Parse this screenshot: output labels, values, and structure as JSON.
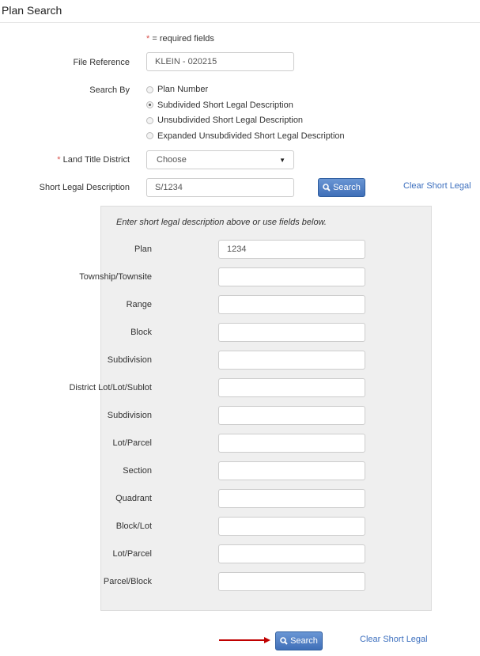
{
  "title": "Plan Search",
  "required_note": {
    "star": "*",
    "text": " = required fields"
  },
  "file_reference": {
    "label": "File Reference",
    "value": "KLEIN - 020215"
  },
  "search_by": {
    "label": "Search By",
    "options": [
      {
        "label": "Plan Number",
        "checked": false
      },
      {
        "label": "Subdivided Short Legal Description",
        "checked": true
      },
      {
        "label": "Unsubdivided Short Legal Description",
        "checked": false
      },
      {
        "label": "Expanded Unsubdivided Short Legal Description",
        "checked": false
      }
    ]
  },
  "land_title_district": {
    "star": "*",
    "label": " Land Title District",
    "value": "Choose"
  },
  "short_legal": {
    "label": "Short Legal Description",
    "value": "S/1234",
    "search_label": "Search",
    "clear_label": "Clear Short Legal"
  },
  "panel": {
    "instruction": "Enter short legal description above or use fields below.",
    "fields": [
      {
        "label": "Plan",
        "value": "1234"
      },
      {
        "label": "Township/Townsite",
        "value": ""
      },
      {
        "label": "Range",
        "value": ""
      },
      {
        "label": "Block",
        "value": ""
      },
      {
        "label": "Subdivision",
        "value": ""
      },
      {
        "label": "District Lot/Lot/Sublot",
        "value": ""
      },
      {
        "label": "Subdivision",
        "value": ""
      },
      {
        "label": "Lot/Parcel",
        "value": ""
      },
      {
        "label": "Section",
        "value": ""
      },
      {
        "label": "Quadrant",
        "value": ""
      },
      {
        "label": "Block/Lot",
        "value": ""
      },
      {
        "label": "Lot/Parcel",
        "value": ""
      },
      {
        "label": "Parcel/Block",
        "value": ""
      }
    ]
  },
  "bottom": {
    "search_label": "Search",
    "clear_label": "Clear Short Legal"
  },
  "colors": {
    "accent": "#3f6fb8",
    "link": "#3c6fbe",
    "required": "#d9534f",
    "arrow": "#c00000"
  }
}
